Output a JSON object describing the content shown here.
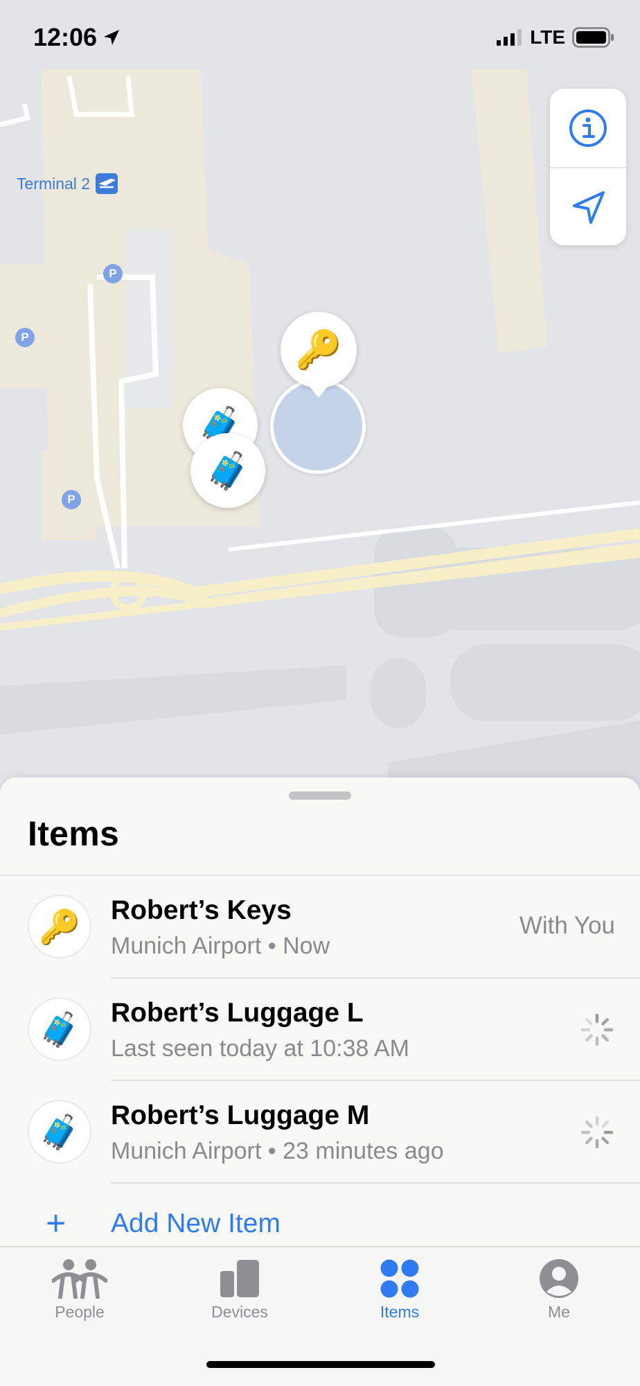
{
  "status_bar": {
    "time": "12:06",
    "network": "LTE"
  },
  "map": {
    "terminal_label": "Terminal 2",
    "parking_label": "P",
    "controls": {
      "info_icon": "info-icon",
      "location_icon": "location-arrow-icon"
    },
    "pins": [
      {
        "icon": "key-icon",
        "glyph": "🔑"
      },
      {
        "icon": "luggage-icon",
        "glyph": "🧳"
      },
      {
        "icon": "luggage-icon",
        "glyph": "🧳"
      }
    ]
  },
  "sheet": {
    "title": "Items",
    "items": [
      {
        "name": "Robert’s Keys",
        "subtitle": "Munich Airport • Now",
        "status": "With You",
        "glyph": "🔑"
      },
      {
        "name": "Robert’s Luggage L",
        "subtitle": "Last seen today at 10:38 AM",
        "status": "",
        "glyph": "🧳"
      },
      {
        "name": "Robert’s Luggage M",
        "subtitle": "Munich Airport • 23 minutes ago",
        "status": "",
        "glyph": "🧳"
      }
    ],
    "add_label": "Add New Item",
    "add_glyph": "+"
  },
  "tabs": [
    {
      "label": "People",
      "active": false
    },
    {
      "label": "Devices",
      "active": false
    },
    {
      "label": "Items",
      "active": true
    },
    {
      "label": "Me",
      "active": false
    }
  ],
  "colors": {
    "accent": "#2f7bf5",
    "secondary_text": "#8a8a8e",
    "map_background": "#e2e4e8",
    "accuracy_circle": "#c5d3e9"
  }
}
